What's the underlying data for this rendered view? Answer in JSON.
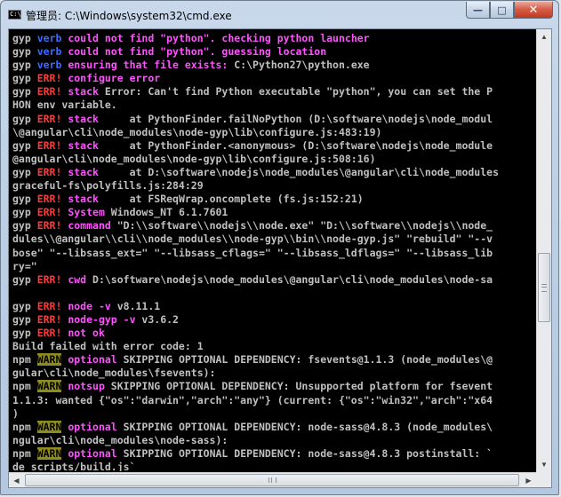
{
  "window": {
    "title": "管理员: C:\\Windows\\system32\\cmd.exe",
    "icon": "cmd-icon",
    "controls": {
      "minimize": "—",
      "maximize": "□",
      "close": "✕"
    }
  },
  "console": {
    "lines": [
      {
        "prefix": "gyp ",
        "tag": "verb",
        "rest": " could not find \"python\". checking python launcher",
        "rest_class": "magenta"
      },
      {
        "prefix": "gyp ",
        "tag": "verb",
        "rest": " could not find \"python\". guessing location",
        "rest_class": "magenta"
      },
      {
        "prefix": "gyp ",
        "tag": "verb",
        "rest": " ensuring that file exists:",
        "rest_class": "magenta",
        "tail": " C:\\Python27\\python.exe"
      },
      {
        "prefix": "gyp ",
        "tag": "ERR!",
        "rest": " configure error",
        "rest_class": "magenta"
      },
      {
        "prefix": "gyp ",
        "tag": "ERR!",
        "rest": " stack",
        "rest_class": "magenta",
        "tail": " Error: Can't find Python executable \"python\", you can set the P"
      },
      {
        "text": "HON env variable."
      },
      {
        "prefix": "gyp ",
        "tag": "ERR!",
        "rest": " stack",
        "rest_class": "magenta",
        "tail": "     at PythonFinder.failNoPython (D:\\software\\nodejs\\node_modul"
      },
      {
        "text": "\\@angular\\cli\\node_modules\\node-gyp\\lib\\configure.js:483:19)"
      },
      {
        "prefix": "gyp ",
        "tag": "ERR!",
        "rest": " stack",
        "rest_class": "magenta",
        "tail": "     at PythonFinder.<anonymous> (D:\\software\\nodejs\\node_module"
      },
      {
        "text": "@angular\\cli\\node_modules\\node-gyp\\lib\\configure.js:508:16)"
      },
      {
        "prefix": "gyp ",
        "tag": "ERR!",
        "rest": " stack",
        "rest_class": "magenta",
        "tail": "     at D:\\software\\nodejs\\node_modules\\@angular\\cli\\node_modules"
      },
      {
        "text": "graceful-fs\\polyfills.js:284:29"
      },
      {
        "prefix": "gyp ",
        "tag": "ERR!",
        "rest": " stack",
        "rest_class": "magenta",
        "tail": "     at FSReqWrap.oncomplete (fs.js:152:21)"
      },
      {
        "prefix": "gyp ",
        "tag": "ERR!",
        "rest": " System",
        "rest_class": "magenta",
        "tail": " Windows_NT 6.1.7601"
      },
      {
        "prefix": "gyp ",
        "tag": "ERR!",
        "rest": " command",
        "rest_class": "magenta",
        "tail": " \"D:\\\\software\\\\nodejs\\\\node.exe\" \"D:\\\\software\\\\nodejs\\\\node_"
      },
      {
        "text": "dules\\\\@angular\\\\cli\\\\node_modules\\\\node-gyp\\\\bin\\\\node-gyp.js\" \"rebuild\" \"--v"
      },
      {
        "text": "bose\" \"--libsass_ext=\" \"--libsass_cflags=\" \"--libsass_ldflags=\" \"--libsass_lib"
      },
      {
        "text": "ry=\""
      },
      {
        "prefix": "gyp ",
        "tag": "ERR!",
        "rest": " cwd",
        "rest_class": "magenta",
        "tail": " D:\\software\\nodejs\\node_modules\\@angular\\cli\\node_modules\\node-sa"
      },
      {
        "text": ""
      },
      {
        "prefix": "gyp ",
        "tag": "ERR!",
        "rest": " node -v",
        "rest_class": "magenta",
        "tail": " v8.11.1"
      },
      {
        "prefix": "gyp ",
        "tag": "ERR!",
        "rest": " node-gyp -v",
        "rest_class": "magenta",
        "tail": " v3.6.2"
      },
      {
        "prefix": "gyp ",
        "tag": "ERR!",
        "rest": " not ok",
        "rest_class": "magenta"
      },
      {
        "text": "Build failed with error code: 1"
      },
      {
        "prefix": "npm ",
        "tag": "WARN",
        "rest": " optional",
        "rest_class": "magenta",
        "tail": " SKIPPING OPTIONAL DEPENDENCY: fsevents@1.1.3 (node_modules\\@"
      },
      {
        "text": "gular\\cli\\node_modules\\fsevents):"
      },
      {
        "prefix": "npm ",
        "tag": "WARN",
        "rest": " notsup",
        "rest_class": "magenta",
        "tail": " SKIPPING OPTIONAL DEPENDENCY: Unsupported platform for fsevent"
      },
      {
        "text": "1.1.3: wanted {\"os\":\"darwin\",\"arch\":\"any\"} (current: {\"os\":\"win32\",\"arch\":\"x64"
      },
      {
        "text": ")"
      },
      {
        "prefix": "npm ",
        "tag": "WARN",
        "rest": " optional",
        "rest_class": "magenta",
        "tail": " SKIPPING OPTIONAL DEPENDENCY: node-sass@4.8.3 (node_modules\\"
      },
      {
        "text": "ngular\\cli\\node_modules\\node-sass):"
      },
      {
        "prefix": "npm ",
        "tag": "WARN",
        "rest": " optional",
        "rest_class": "magenta",
        "tail": " SKIPPING OPTIONAL DEPENDENCY: node-sass@4.8.3 postinstall: `"
      },
      {
        "text": "de scripts/build.js`"
      }
    ]
  },
  "scrollbars": {
    "vertical": {
      "up": "▲",
      "down": "▼",
      "position": 0.61
    },
    "horizontal": {
      "left": "◀",
      "right": "▶",
      "grip": "III"
    }
  },
  "colors": {
    "verb": "#3a6cff",
    "err": "#ff3838",
    "warn_bg": "#8c8c20",
    "magenta": "#ff52ff",
    "text": "#c0c0c0"
  }
}
